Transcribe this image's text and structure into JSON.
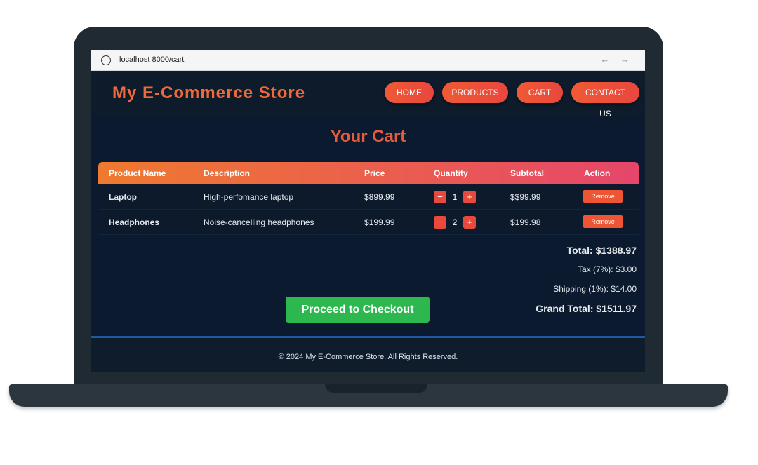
{
  "browser": {
    "url": "localhost 8000/cart",
    "nav_arrows": "← →"
  },
  "header": {
    "logo": "My E-Commerce Store",
    "nav": [
      "HOME",
      "PRODUCTS",
      "CART",
      "CONTACT US"
    ]
  },
  "cart": {
    "title": "Your Cart",
    "columns": [
      "Product Name",
      "Description",
      "Price",
      "Quantity",
      "Subtotal",
      "Action"
    ],
    "rows": [
      {
        "name": "Laptop",
        "description": "High-perfomance laptop",
        "price": "$899.99",
        "qty": "1",
        "subtotal": "$$99.99",
        "action": "Remove"
      },
      {
        "name": "Headphones",
        "description": "Noise-cancelling headphones",
        "price": "$199.99",
        "qty": "2",
        "subtotal": "$199.98",
        "action": "Remove"
      }
    ],
    "qty_minus": "−",
    "qty_plus": "+",
    "total": "Total: $1388.97",
    "tax": "Tax (7%): $3.00",
    "shipping": "Shipping (1%): $14.00",
    "grand_total": "Grand Total: $1511.97",
    "checkout": "Proceed to Checkout"
  },
  "footer": {
    "text": "© 2024 My E-Commerce Store. All Rights Reserved."
  },
  "colors": {
    "accent": "#ef6a3a",
    "checkout": "#2db84f",
    "background": "#0b1a2e"
  }
}
